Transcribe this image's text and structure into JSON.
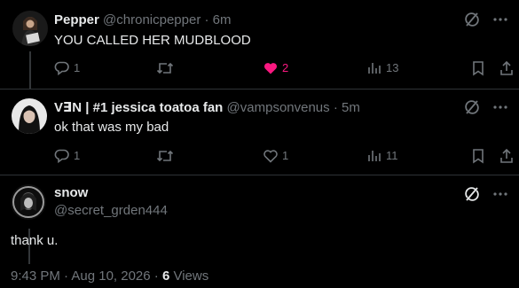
{
  "replies": [
    {
      "name": "Pepper",
      "handle": "@chronicpepper",
      "separator": "·",
      "time": "6m",
      "text": "YOU CALLED HER MUDBLOOD",
      "reply_count": "1",
      "repost_count": "",
      "like_count": "2",
      "liked": true,
      "view_count": "13"
    },
    {
      "name": "V∃N | #1 jessica toatoa fan",
      "handle": "@vampsonvenus",
      "separator": "·",
      "time": "5m",
      "text": "ok that was my bad",
      "reply_count": "1",
      "repost_count": "",
      "like_count": "1",
      "liked": false,
      "view_count": "11"
    }
  ],
  "main_post": {
    "name": "snow",
    "handle": "@secret_grden444",
    "text": "thank u.",
    "datetime": "9:43 PM · Aug 10, 2026 · ",
    "views_count": "6",
    "views_label": " Views"
  },
  "icons": {
    "grok": "grok-icon",
    "more": "more-icon",
    "reply": "reply-icon",
    "repost": "repost-icon",
    "like": "heart-icon",
    "views": "views-icon",
    "bookmark": "bookmark-icon",
    "share": "share-icon"
  },
  "colors": {
    "background": "#000000",
    "text_primary": "#e7e9ea",
    "text_secondary": "#71767b",
    "like_active": "#f91880",
    "divider": "#2f3336"
  }
}
